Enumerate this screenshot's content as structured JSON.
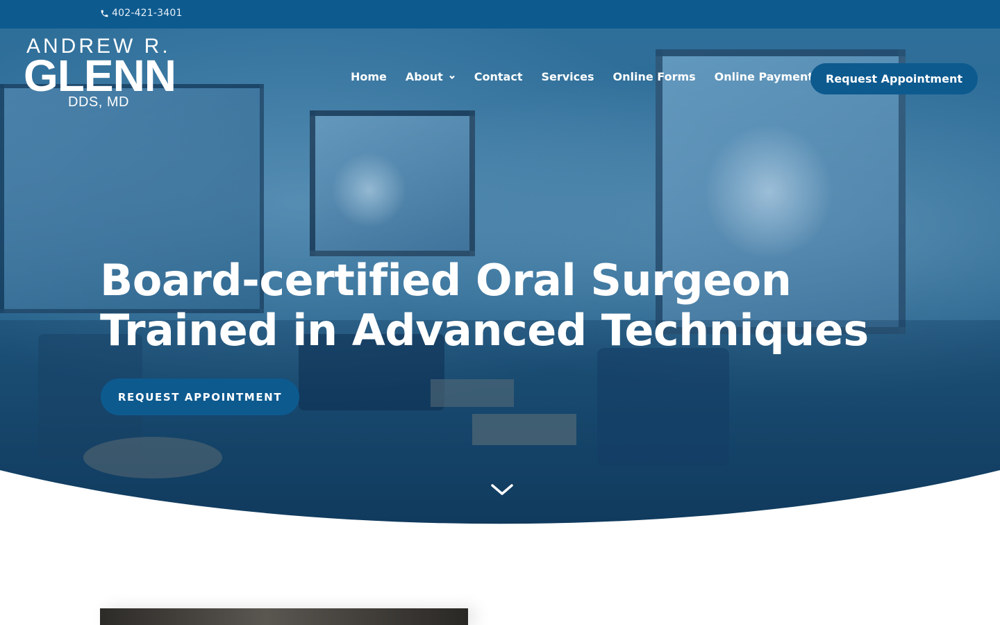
{
  "topbar": {
    "phone": "402-421-3401",
    "phone_icon": "phone-icon"
  },
  "logo": {
    "line1": "ANDREW R.",
    "line2": "GLENN",
    "line3": "DDS, MD"
  },
  "nav": {
    "items": [
      {
        "label": "Home"
      },
      {
        "label": "About",
        "has_dropdown": true
      },
      {
        "label": "Contact"
      },
      {
        "label": "Services"
      },
      {
        "label": "Online Forms"
      },
      {
        "label": "Online Payment"
      }
    ],
    "cta": "Request Appointment"
  },
  "hero": {
    "headline_line1": "Board-certified Oral Surgeon",
    "headline_line2": "Trained in Advanced Techniques",
    "cta": "REQUEST APPOINTMENT",
    "scroll_icon": "chevron-down-icon"
  },
  "colors": {
    "brand": "#0d5a8f",
    "overlay": "#2a6791",
    "text": "#ffffff"
  }
}
